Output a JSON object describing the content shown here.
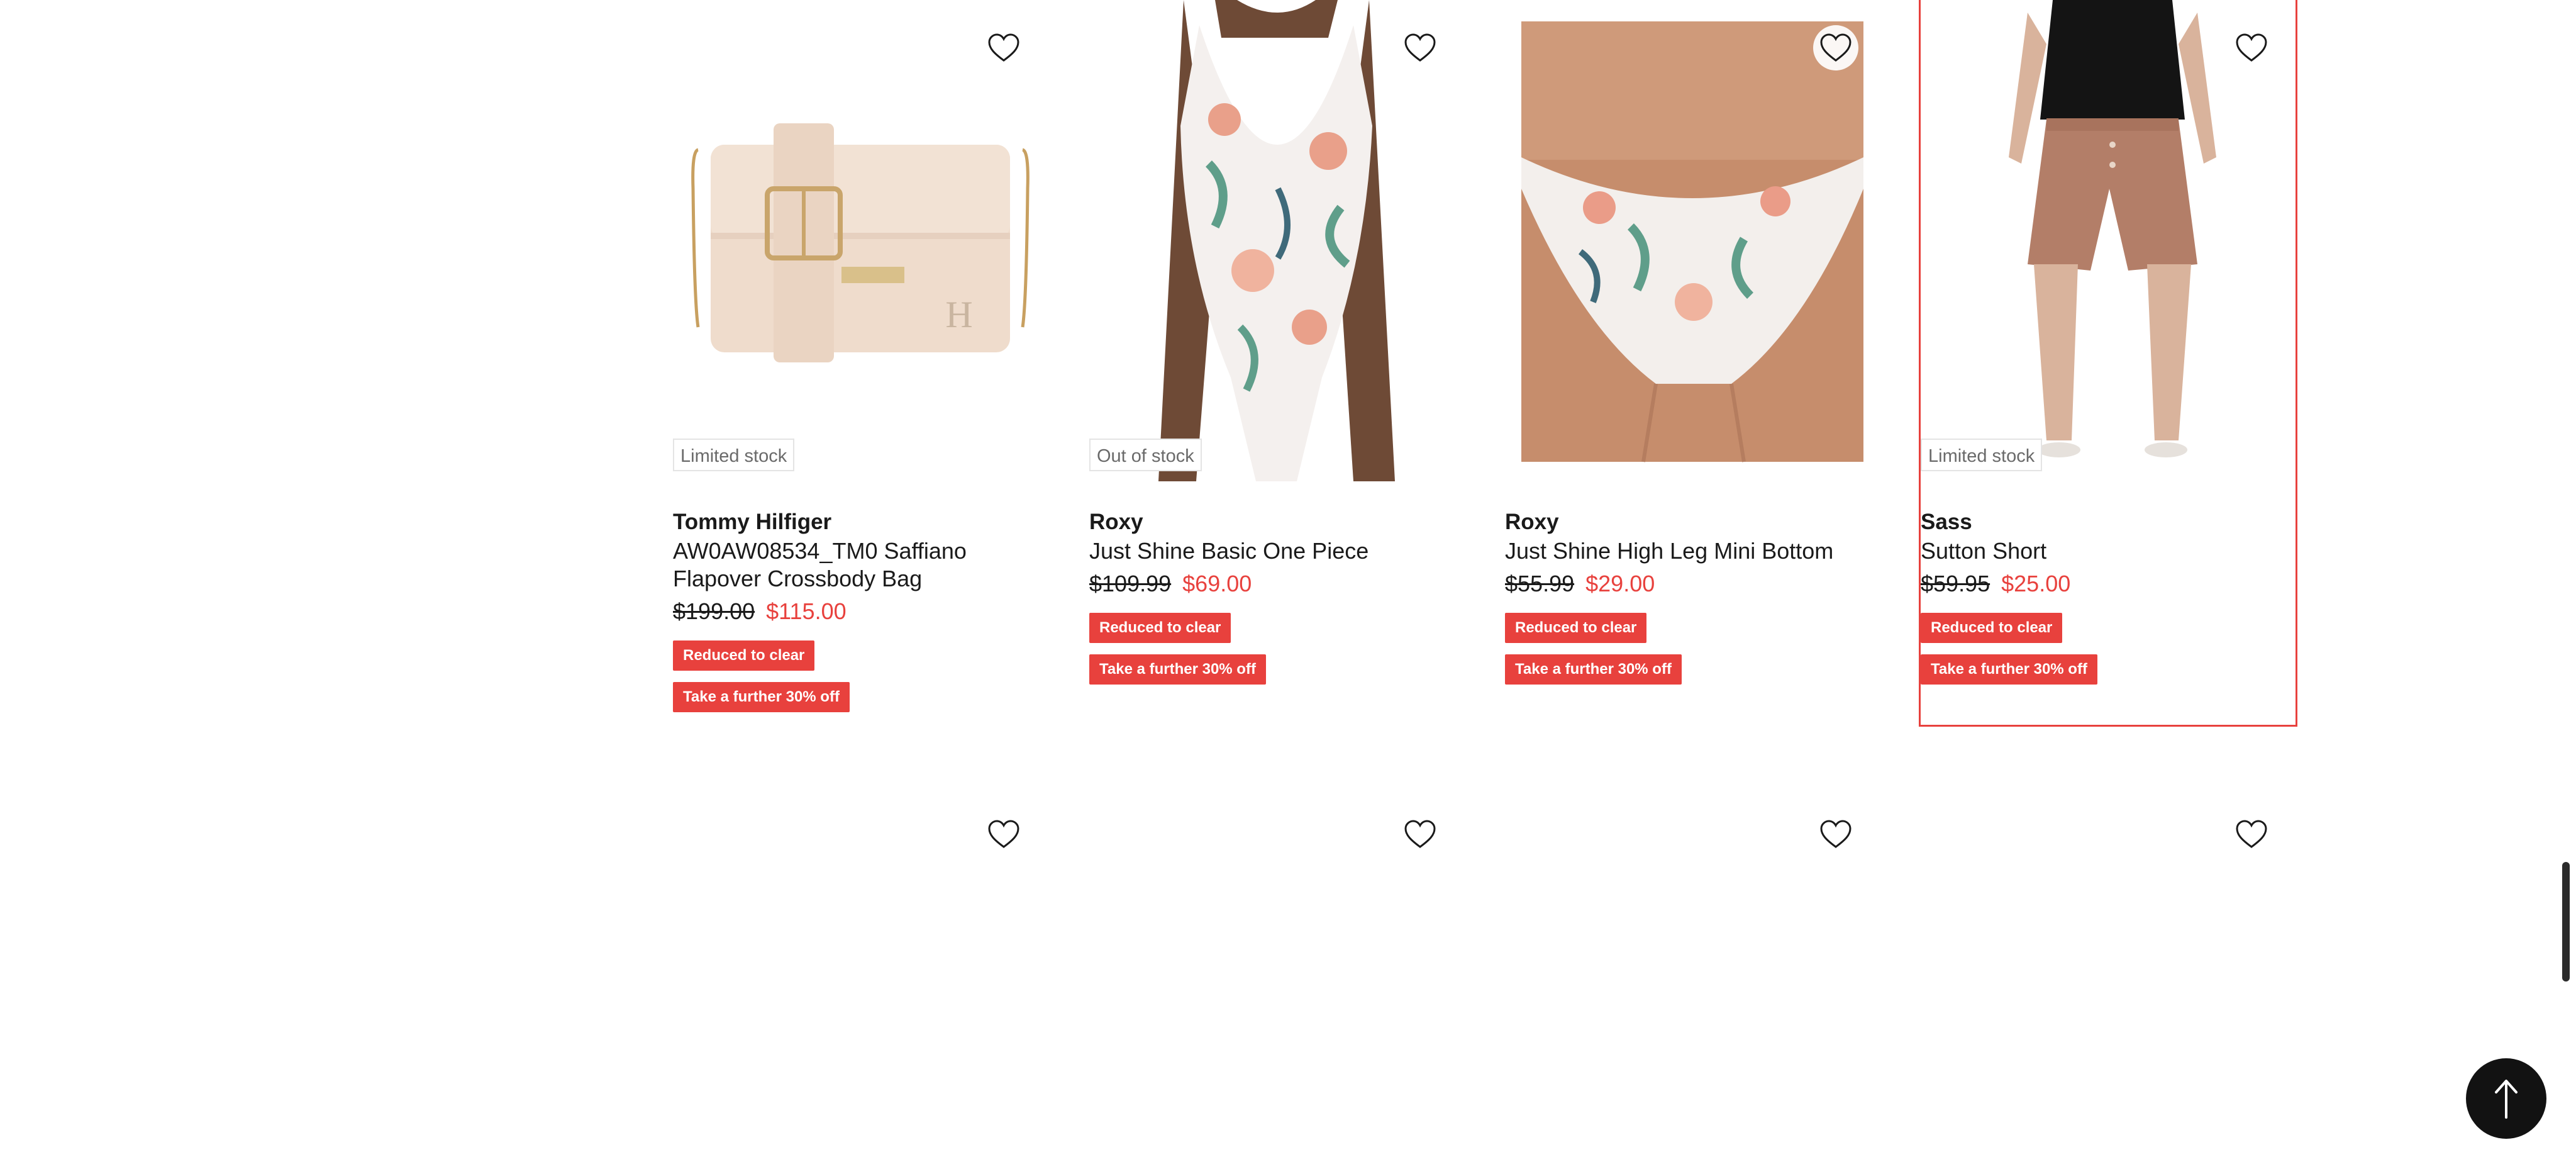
{
  "products_row1": [
    {
      "stock": "Limited stock",
      "brand": "Tommy Hilfiger",
      "name": "AW0AW08534_TM0 Saffiano Flapover Crossbody Bag",
      "was_price": "$199.00",
      "now_price": "$115.00",
      "badge1": "Reduced to clear",
      "badge2": "Take a further 30% off",
      "image": "beige-crossbody-bag"
    },
    {
      "stock": "Out of stock",
      "brand": "Roxy",
      "name": "Just Shine Basic One Piece",
      "was_price": "$109.99",
      "now_price": "$69.00",
      "badge1": "Reduced to clear",
      "badge2": "Take a further 30% off",
      "image": "floral-one-piece-swimsuit"
    },
    {
      "stock": "",
      "brand": "Roxy",
      "name": "Just Shine High Leg Mini Bottom",
      "was_price": "$55.99",
      "now_price": "$29.00",
      "badge1": "Reduced to clear",
      "badge2": "Take a further 30% off",
      "image": "floral-bikini-bottom"
    },
    {
      "stock": "Limited stock",
      "brand": "Sass",
      "name": "Sutton Short",
      "was_price": "$59.95",
      "now_price": "$25.00",
      "badge1": "Reduced to clear",
      "badge2": "Take a further 30% off",
      "image": "rust-linen-shorts"
    }
  ],
  "colors": {
    "accent": "#e8413d",
    "text": "#1a1a1a",
    "muted": "#6a6a6a",
    "button_dark": "#121212"
  },
  "icons": {
    "wishlist": "heart-outline-icon",
    "back_to_top": "arrow-up-icon"
  }
}
